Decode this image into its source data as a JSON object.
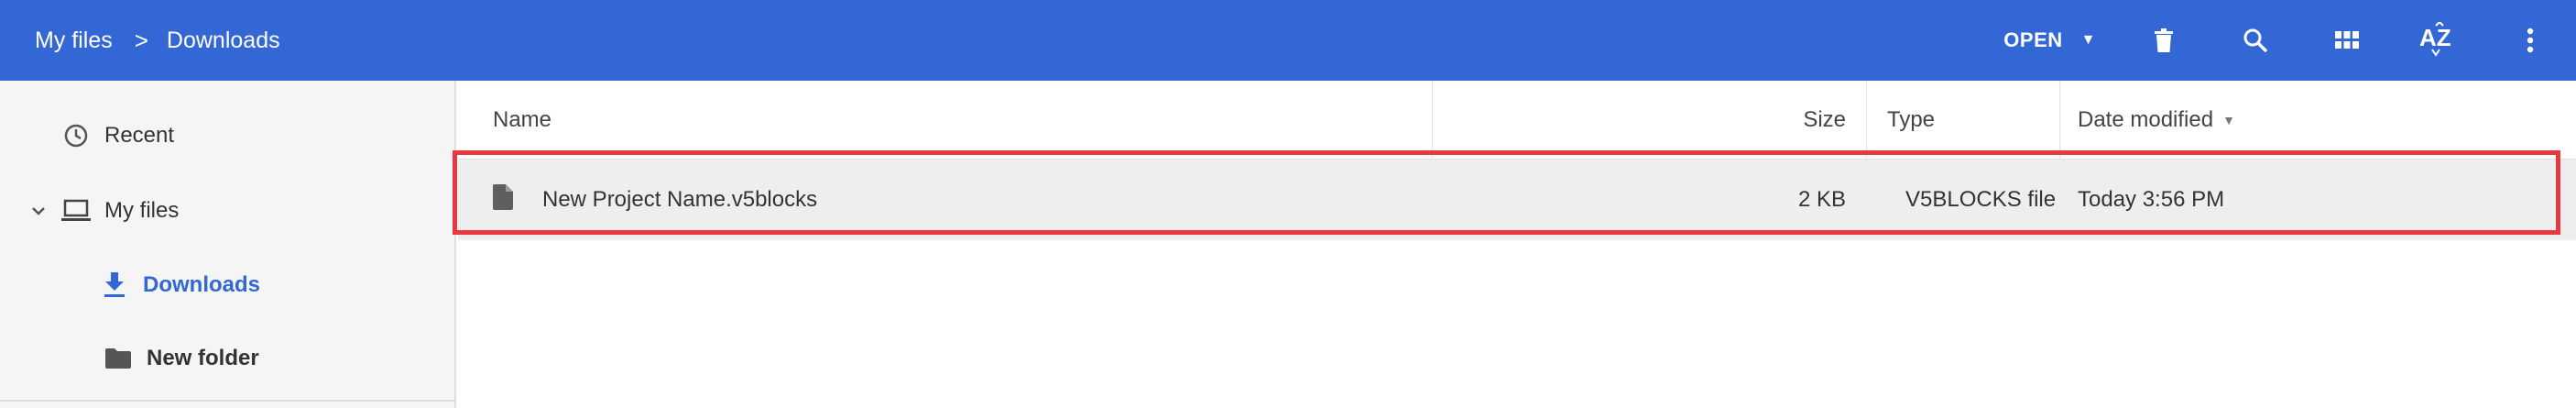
{
  "breadcrumb": {
    "root": "My files",
    "separator": ">",
    "current": "Downloads"
  },
  "toolbar": {
    "open_label": "OPEN",
    "icons": [
      "trash-icon",
      "search-icon",
      "grid-view-icon",
      "sort-az-icon",
      "more-vert-icon"
    ]
  },
  "sidebar": {
    "items": [
      {
        "label": "Recent",
        "icon": "clock-icon"
      },
      {
        "label": "My files",
        "icon": "laptop-icon",
        "expanded": true
      },
      {
        "label": "Downloads",
        "icon": "download-icon",
        "selected": true
      },
      {
        "label": "New folder",
        "icon": "folder-icon"
      }
    ]
  },
  "list": {
    "columns": {
      "name": "Name",
      "size": "Size",
      "type": "Type",
      "date": "Date modified"
    },
    "rows": [
      {
        "name": "New Project Name.v5blocks",
        "size": "2 KB",
        "type": "V5BLOCKS file",
        "date": "Today 3:56 PM"
      }
    ]
  },
  "colors": {
    "header_blue": "#3367d6",
    "selected_row": "#eeeeee",
    "highlight_red": "#e8373e",
    "sidebar_bg": "#f5f5f5"
  }
}
